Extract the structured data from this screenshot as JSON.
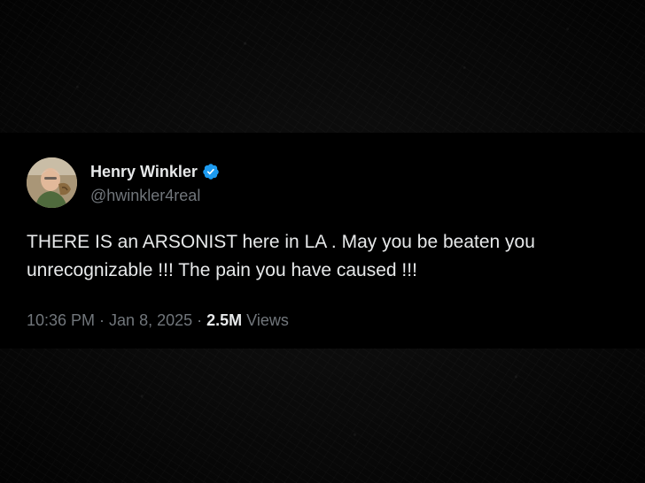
{
  "tweet": {
    "author": {
      "display_name": "Henry Winkler",
      "handle": "@hwinkler4real",
      "verified": true,
      "verified_icon": "verified-badge-icon",
      "verified_color": "#1d9bf0"
    },
    "text": "THERE IS an ARSONIST here in LA . May you be beaten you unrecognizable !!! The pain you have caused !!!",
    "time": "10:36 PM",
    "date": "Jan 8, 2025",
    "separator": "·",
    "views_count": "2.5M",
    "views_label": "Views"
  },
  "colors": {
    "card_background": "#000000",
    "primary_text": "#e7e9ea",
    "secondary_text": "#71767b"
  }
}
